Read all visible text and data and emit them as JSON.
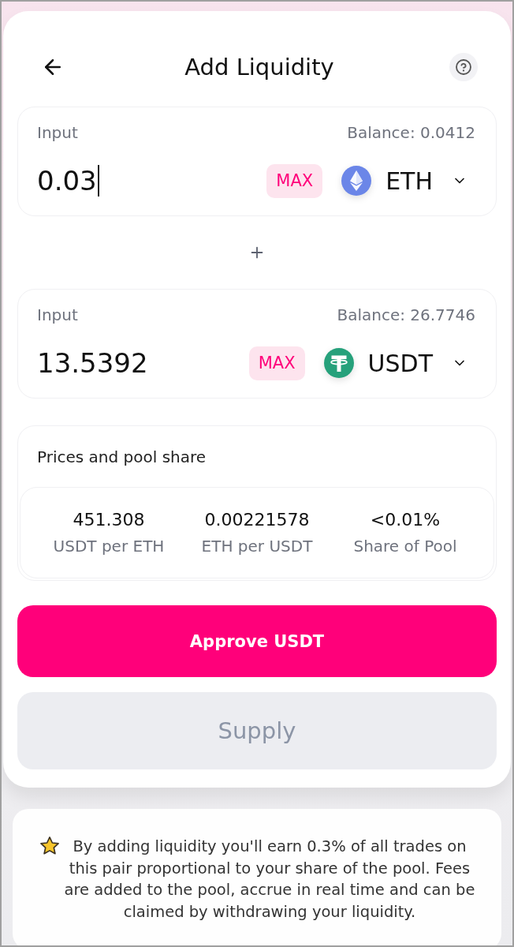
{
  "header": {
    "title": "Add Liquidity"
  },
  "inputs": [
    {
      "label": "Input",
      "balance": "Balance: 0.0412",
      "value": "0.03",
      "focused": true,
      "max_label": "MAX",
      "token": {
        "symbol": "ETH",
        "kind": "eth"
      }
    },
    {
      "label": "Input",
      "balance": "Balance: 26.7746",
      "value": "13.5392",
      "focused": false,
      "max_label": "MAX",
      "token": {
        "symbol": "USDT",
        "kind": "usdt"
      }
    }
  ],
  "prices": {
    "title": "Prices and pool share",
    "stats": [
      {
        "value": "451.308",
        "label": "USDT per ETH"
      },
      {
        "value": "0.00221578",
        "label": "ETH per USDT"
      },
      {
        "value": "<0.01%",
        "label": "Share of Pool"
      }
    ]
  },
  "buttons": [
    {
      "label": "Approve USDT",
      "disabled": false
    },
    {
      "label": "Supply",
      "disabled": true
    }
  ],
  "note": {
    "text": "By adding liquidity you'll earn 0.3% of all trades on this pair proportional to your share of the pool. Fees are added to the pool, accrue in real time and can be claimed by withdrawing your liquidity."
  }
}
